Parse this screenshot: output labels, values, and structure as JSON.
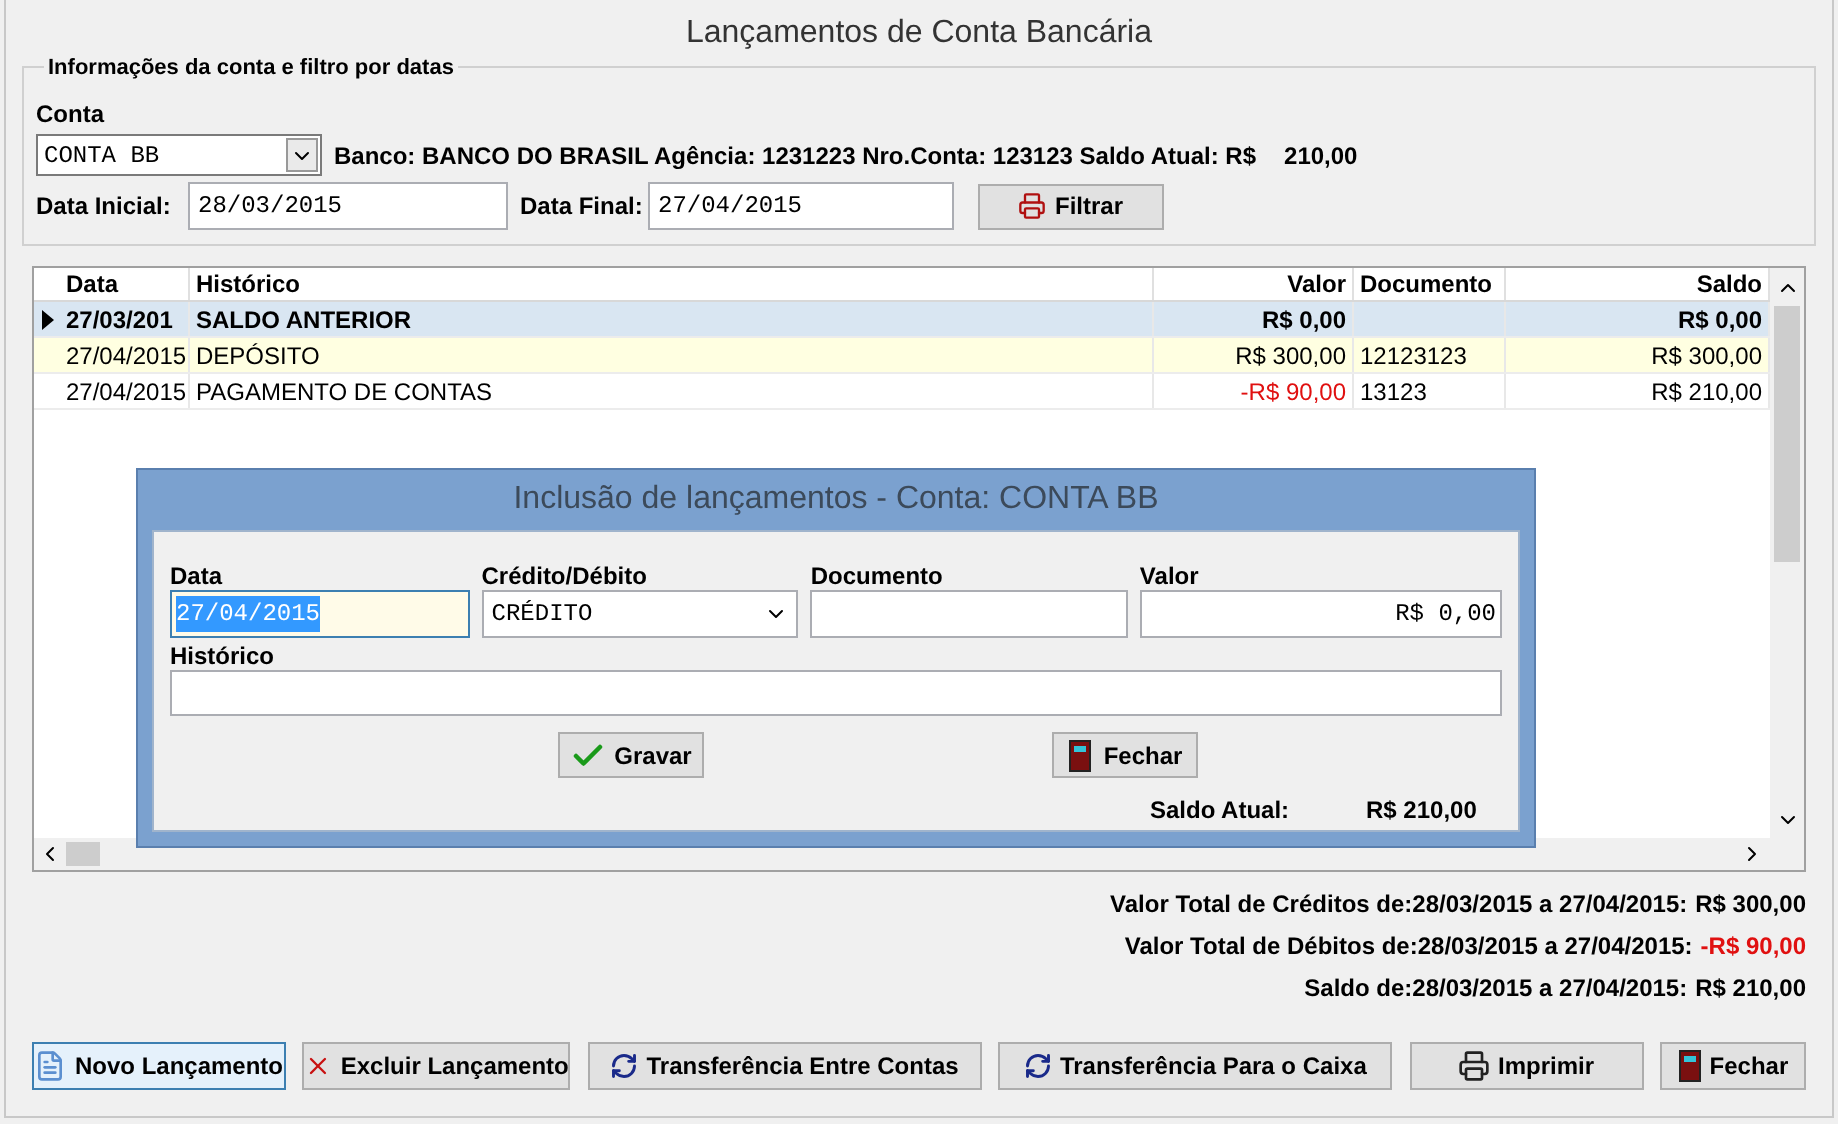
{
  "window": {
    "title": "Lançamentos de Conta Bancária"
  },
  "filter": {
    "legend": "Informações da conta e filtro por datas",
    "account_label": "Conta",
    "account_value": "CONTA BB",
    "account_info": "Banco: BANCO DO BRASIL Agência: 1231223 Nro.Conta: 123123 Saldo Atual: R$",
    "balance": "210,00",
    "start_label": "Data Inicial:",
    "start_value": "28/03/2015",
    "end_label": "Data Final:",
    "end_value": "27/04/2015",
    "filter_button": "Filtrar"
  },
  "table": {
    "columns": [
      "Data",
      "Histórico",
      "Valor",
      "Documento",
      "Saldo"
    ],
    "rows": [
      {
        "cells": [
          "27/03/201",
          "SALDO ANTERIOR",
          "R$ 0,00",
          null,
          "R$ 0,00"
        ],
        "kind": "opening",
        "selected": true,
        "highlighted": false,
        "negative": false
      },
      {
        "cells": [
          "27/04/2015",
          "DEPÓSITO",
          "R$ 300,00",
          "12123123",
          "R$ 300,00"
        ],
        "kind": "entry",
        "selected": false,
        "highlighted": true,
        "negative": false
      },
      {
        "cells": [
          "27/04/2015",
          "PAGAMENTO DE CONTAS",
          "-R$ 90,00",
          "13123",
          "R$ 210,00"
        ],
        "kind": "entry",
        "selected": false,
        "highlighted": false,
        "negative": true
      }
    ]
  },
  "dialog": {
    "title": "Inclusão de lançamentos - Conta: CONTA BB",
    "fields": [
      {
        "label": "Data",
        "value": "27/04/2015",
        "kind": "date",
        "focused": true
      },
      {
        "label": "Crédito/Débito",
        "value": "CRÉDITO",
        "kind": "select",
        "focused": false
      },
      {
        "label": "Documento",
        "kind": "text",
        "focused": false
      },
      {
        "label": "Valor",
        "value": "R$ 0,00",
        "kind": "money",
        "focused": false
      }
    ],
    "history_label": "Histórico",
    "save_button": "Gravar",
    "close_button": "Fechar",
    "balance_label": "Saldo Atual:",
    "balance_value": "R$ 210,00"
  },
  "totals": [
    {
      "label": "Valor Total de Créditos de:28/03/2015 a 27/04/2015:",
      "value": "R$ 300,00",
      "negative": false
    },
    {
      "label": "Valor Total de Débitos de:28/03/2015 a 27/04/2015:",
      "value": "-R$ 90,00",
      "negative": true
    },
    {
      "label": "Saldo de:28/03/2015 a 27/04/2015:",
      "value": "R$ 210,00",
      "negative": false
    }
  ],
  "buttons": [
    {
      "label": "Novo Lançamento",
      "kind": "new",
      "focused": true
    },
    {
      "label": "Excluir Lançamento",
      "kind": "delete",
      "focused": false
    },
    {
      "label": "Transferência Entre Contas",
      "kind": "transfer",
      "focused": false
    },
    {
      "label": "Transferência Para o Caixa",
      "kind": "transfer",
      "focused": false
    },
    {
      "label": "Imprimir",
      "kind": "print",
      "focused": false
    },
    {
      "label": "Fechar",
      "kind": "close",
      "focused": false
    }
  ]
}
